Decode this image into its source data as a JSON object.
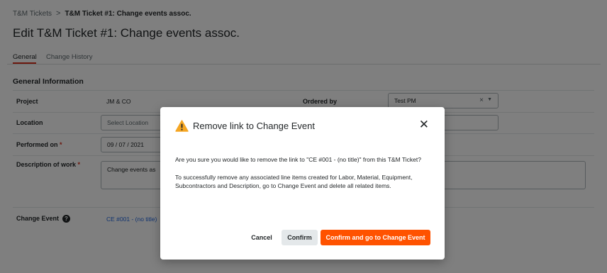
{
  "breadcrumb": {
    "root": "T&M Tickets",
    "separator": ">",
    "current": "T&M Ticket #1: Change events assoc."
  },
  "page_title": "Edit T&M Ticket #1: Change events assoc.",
  "tabs": [
    {
      "label": "General",
      "active": true
    },
    {
      "label": "Change History",
      "active": false
    }
  ],
  "section_title": "General Information",
  "form": {
    "project": {
      "label": "Project",
      "value": "JM & CO"
    },
    "ordered_by": {
      "label": "Ordered by",
      "value": "Test PM",
      "clear": "×",
      "caret": "▼"
    },
    "location": {
      "label": "Location",
      "placeholder": "Select Location"
    },
    "performed_on": {
      "label": "Performed on",
      "required_mark": "*",
      "value": "09 / 07 / 2021",
      "clear": "×"
    },
    "description": {
      "label": "Description of work",
      "required_mark": "*",
      "value": "Change events as"
    },
    "change_event": {
      "label": "Change Event",
      "help_glyph": "?",
      "value": "CE #001 - (no title)"
    }
  },
  "modal": {
    "title": "Remove link to Change Event",
    "close_glyph": "✕",
    "paragraph_1": "Are you sure you would like to remove the link to \"CE #001 - (no title)\" from this T&M Ticket?",
    "paragraph_2": "To successfully remove any associated line items created for Labor, Material, Equipment, Subcontractors and Description, go to Change Event and delete all related items.",
    "cancel_label": "Cancel",
    "confirm_label": "Confirm",
    "confirm_go_label": "Confirm and go to Change Event"
  },
  "colors": {
    "primary_button": "#ff5200",
    "tab_accent": "#d9311c",
    "link": "#2066df",
    "warning": "#f5a623",
    "overlay": "rgba(0,0,0,0.5)"
  },
  "icons": [
    "chevron-right-icon",
    "warning-icon",
    "close-icon",
    "help-icon",
    "caret-down-icon",
    "clear-icon"
  ]
}
